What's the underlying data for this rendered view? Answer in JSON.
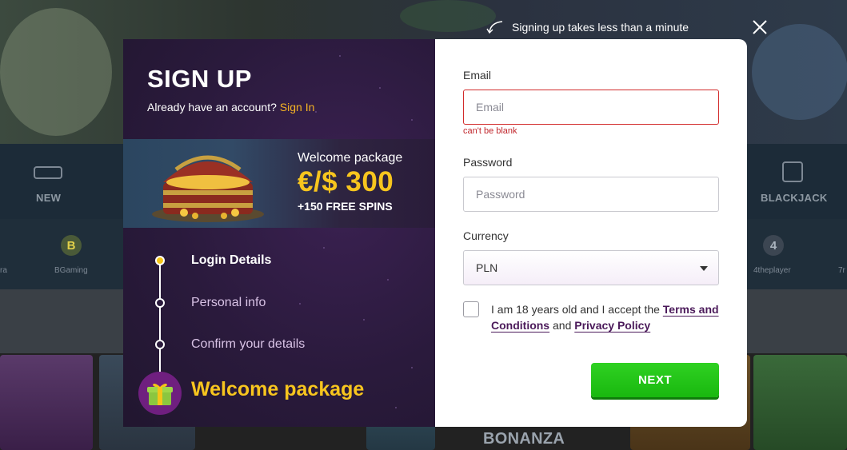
{
  "background": {
    "categories": [
      "NEW",
      "BLACKJACK"
    ],
    "providers": [
      "BGaming",
      "4theplayer"
    ],
    "provider_badges": [
      "B",
      "4"
    ],
    "partial_labels": [
      "ra",
      "7r"
    ],
    "game_tiles": [
      "BONANZA"
    ]
  },
  "hint": {
    "text": "Signing up takes less than a minute"
  },
  "close": {
    "icon": "close-icon"
  },
  "left_panel": {
    "title": "SIGN UP",
    "already_text": "Already have an account?",
    "signin_label": "Sign In",
    "promo": {
      "title": "Welcome package",
      "amount": "€/$ 300",
      "spins": "+150 FREE SPINS"
    },
    "steps": [
      {
        "label": "Login Details",
        "active": true
      },
      {
        "label": "Personal info",
        "active": false
      },
      {
        "label": "Confirm your details",
        "active": false
      }
    ],
    "final_step": "Welcome package"
  },
  "form": {
    "email": {
      "label": "Email",
      "placeholder": "Email",
      "value": "",
      "error": "can't be blank"
    },
    "password": {
      "label": "Password",
      "placeholder": "Password",
      "value": ""
    },
    "currency": {
      "label": "Currency",
      "selected": "PLN"
    },
    "terms": {
      "prefix": "I am 18 years old and I accept the",
      "terms_link": "Terms and Conditions",
      "and": "and",
      "privacy_link": "Privacy Policy",
      "checked": false
    },
    "next_label": "NEXT"
  },
  "colors": {
    "accent_yellow": "#f7c51e",
    "signin_orange": "#f5b324",
    "error_red": "#c0262c",
    "next_green": "#19b80f",
    "panel_purple": "#2a1a3c",
    "link_purple": "#4b1a5a"
  }
}
